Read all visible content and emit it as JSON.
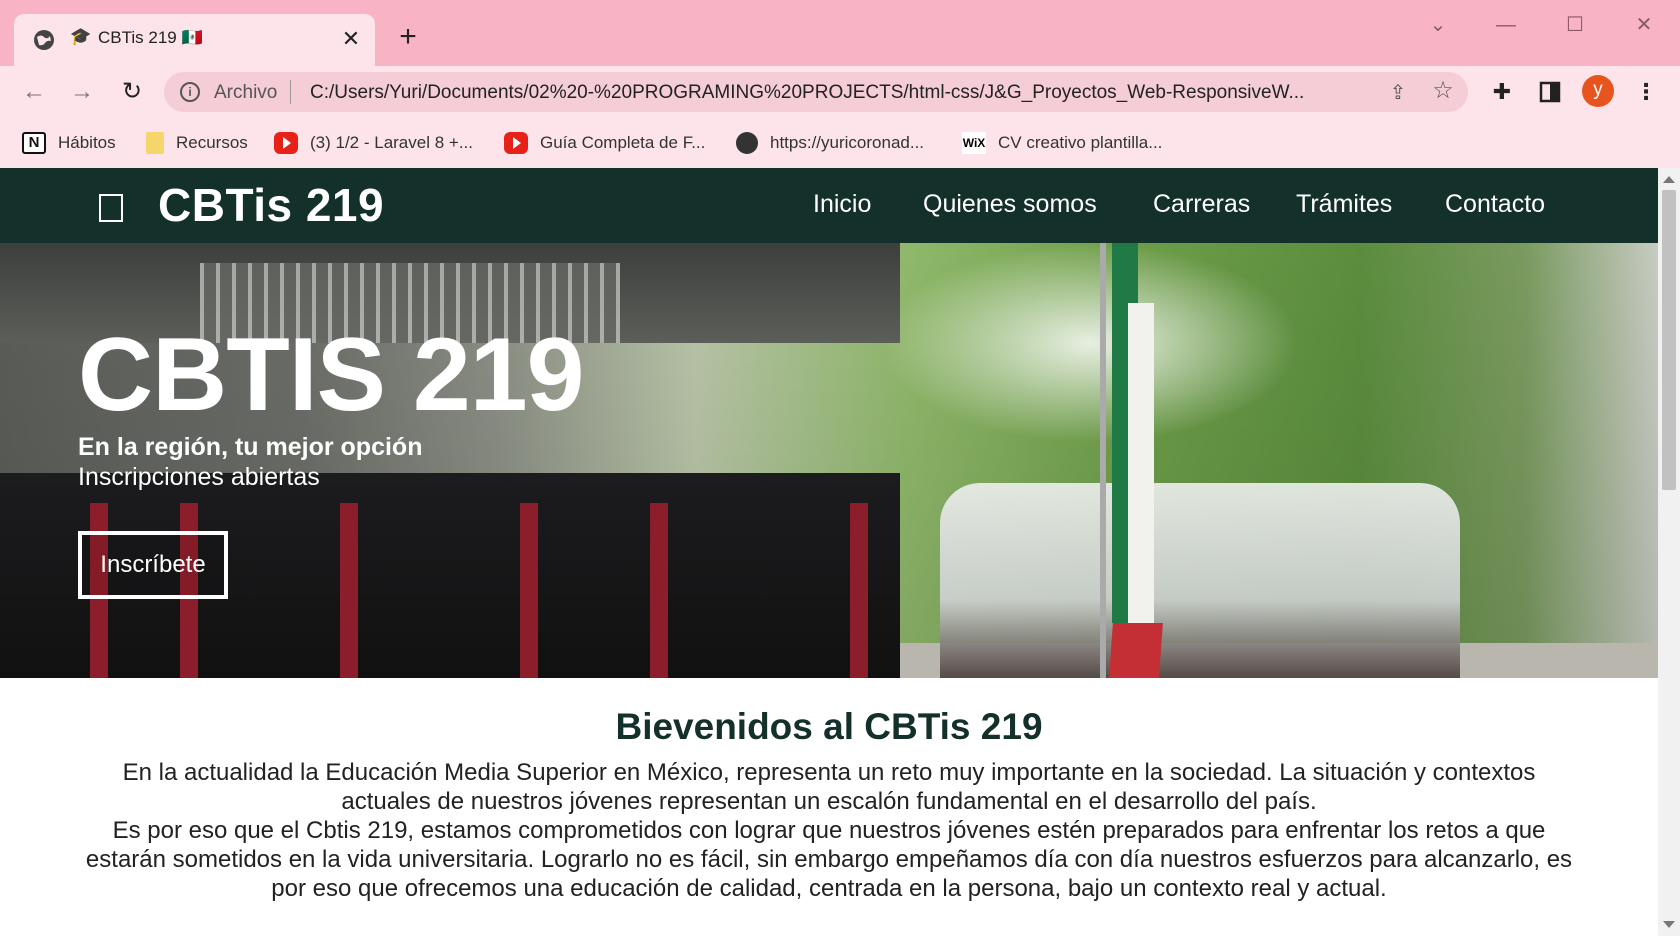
{
  "browser": {
    "tab": {
      "title": "CBTis 219",
      "favicon_emoji": "🎓",
      "flag_emoji": "🇲🇽"
    },
    "omnibox": {
      "scheme_label": "Archivo",
      "url": "C:/Users/Yuri/Documents/02%20-%20PROGRAMING%20PROJECTS/html-css/J&G_Proyectos_Web-ResponsiveW..."
    },
    "profile_initial": "y",
    "bookmarks": [
      {
        "label": "Hábitos",
        "icon": "notion-icon"
      },
      {
        "label": "Recursos",
        "icon": "folder-icon"
      },
      {
        "label": "(3) 1/2 - Laravel 8 +...",
        "icon": "youtube-icon"
      },
      {
        "label": "Guía Completa de F...",
        "icon": "youtube-icon"
      },
      {
        "label": "https://yuricoronad...",
        "icon": "globe-icon"
      },
      {
        "label": "CV creativo plantilla...",
        "icon": "wix-icon"
      }
    ]
  },
  "site": {
    "logo": "CBTis 219",
    "nav": [
      "Inicio",
      "Quienes somos",
      "Carreras",
      "Trámites",
      "Contacto"
    ],
    "hero": {
      "title": "CBTIS 219",
      "subtitle_bold": "En la región, tu mejor opción",
      "subtitle": "Inscripciones abiertas",
      "cta": "Inscríbete"
    },
    "welcome": {
      "heading": "Bievenidos al CBTis 219",
      "paragraph_lines": [
        "En la actualidad la Educación Media Superior en México, representa un reto muy importante en la sociedad. La situación y contextos",
        "actuales de nuestros jóvenes representan un escalón fundamental en el desarrollo del país.",
        "Es por eso que el Cbtis 219, estamos comprometidos con lograr que nuestros jóvenes estén preparados para enfrentar los retos a que",
        "estarán sometidos en la vida universitaria. Lograrlo no es fácil, sin embargo empeñamos día con día nuestros esfuerzos para alcanzarlo, es",
        "por eso que ofrecemos una educación de calidad, centrada en la persona, bajo un contexto real y actual."
      ]
    }
  },
  "colors": {
    "chrome_frame": "#f8b4c4",
    "chrome_toolbar": "#fce4ea",
    "site_header": "#14302a",
    "avatar": "#e8541e"
  }
}
